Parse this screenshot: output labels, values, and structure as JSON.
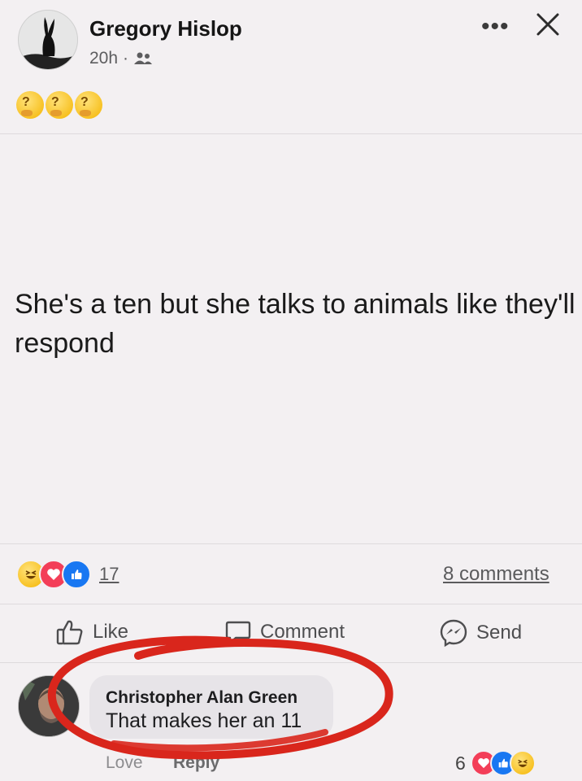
{
  "post": {
    "author": "Gregory Hislop",
    "time": "20h",
    "dot": "·",
    "emojis": [
      "thinking-face",
      "thinking-face",
      "thinking-face"
    ],
    "text": "She's a ten but she talks to animals like they'll respond"
  },
  "reactions": {
    "types": [
      "haha",
      "love",
      "like"
    ],
    "count": "17",
    "comments_label": "8 comments"
  },
  "actions": {
    "like": "Like",
    "comment": "Comment",
    "send": "Send"
  },
  "comment": {
    "author": "Christopher Alan Green",
    "text": "That makes her an 11",
    "love_label": "Love",
    "reply_label": "Reply",
    "reaction_count": "6",
    "reaction_types": [
      "love",
      "like",
      "haha"
    ]
  },
  "colors": {
    "background": "#f3f0f2",
    "like_blue": "#1877f2",
    "love_red": "#f33e58",
    "annotation_red": "#d9261c"
  }
}
